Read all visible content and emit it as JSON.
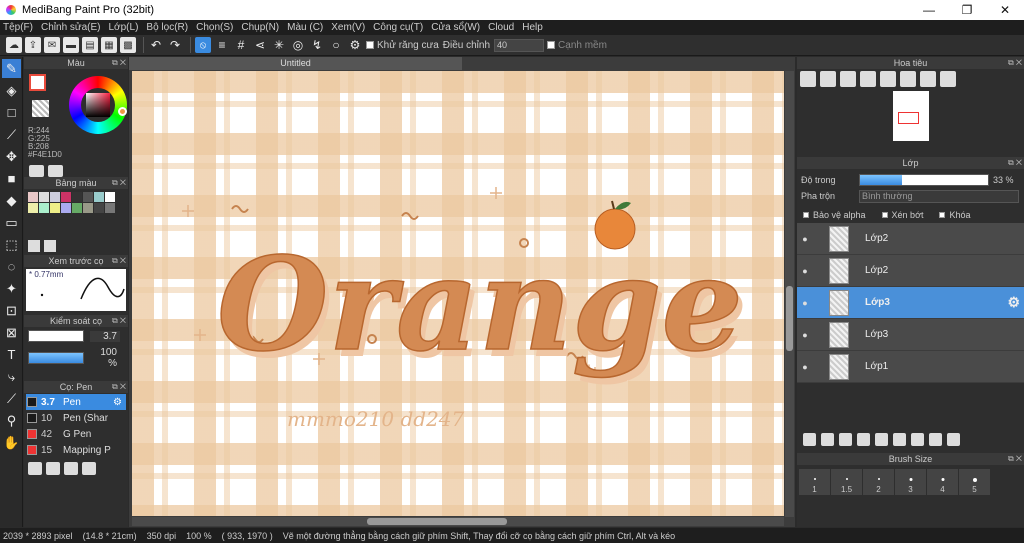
{
  "window": {
    "title": "MediBang Paint Pro (32bit)",
    "minimize": "—",
    "restore": "❐",
    "close": "✕"
  },
  "menu": [
    "Tệp(F)",
    "Chỉnh sửa(E)",
    "Lớp(L)",
    "Bộ lọc(R)",
    "Chọn(S)",
    "Chụp(N)",
    "Màu (C)",
    "Xem(V)",
    "Công cụ(T)",
    "Cửa sổ(W)",
    "Cloud",
    "Help"
  ],
  "toolbar": {
    "antialias_label": "Khử răng cưa",
    "correction_label": "Điều chỉnh",
    "correction_value": "40",
    "sharp_edge_label": "Cạnh mềm"
  },
  "panels": {
    "color_title": "Màu",
    "color_values": {
      "r": "R:244",
      "g": "G:225",
      "b": "B:208",
      "hex": "#F4E1D0"
    },
    "palette_title": "Bảng màu",
    "palette_colors": [
      "#e8c7c7",
      "#ddd",
      "#ccd",
      "#c36",
      "#333",
      "#555",
      "#9cc",
      "#fff",
      "#eea",
      "#aec",
      "#ee8",
      "#aae",
      "#6a6",
      "#998",
      "#444",
      "#777"
    ],
    "brush_preview_title": "Xem trước cọ",
    "brush_preview_size": "* 0.77mm",
    "brush_control_title": "Kiểm soát cọ",
    "brush_size_value": "3.7",
    "brush_opacity_value": "100 %",
    "brush_list_title": "Cọ: Pen",
    "brushes": [
      {
        "size": "3.7",
        "name": "Pen",
        "color": "#1a1a1a",
        "active": true
      },
      {
        "size": "10",
        "name": "Pen (Shar",
        "color": "#1a1a1a",
        "active": false
      },
      {
        "size": "42",
        "name": "G Pen",
        "color": "#e33",
        "active": false
      },
      {
        "size": "15",
        "name": "Mapping P",
        "color": "#e33",
        "active": false
      }
    ],
    "navigator_title": "Hoa tiêu",
    "layer_title": "Lớp",
    "opacity_label": "Độ trong",
    "opacity_value": "33 %",
    "opacity_fraction": 0.33,
    "blend_label": "Pha trộn",
    "blend_value": "Bình thường",
    "protect_alpha": "Bảo vệ alpha",
    "clipping": "Xén bớt",
    "lock": "Khóa",
    "layers": [
      {
        "name": "Lớp2",
        "active": false
      },
      {
        "name": "Lớp2",
        "active": false
      },
      {
        "name": "Lớp3",
        "active": true
      },
      {
        "name": "Lớp3",
        "active": false
      },
      {
        "name": "Lớp1",
        "active": false
      }
    ],
    "brush_size_title": "Brush Size",
    "brush_size_labels": [
      "1",
      "1.5",
      "2",
      "3",
      "4",
      "5"
    ]
  },
  "canvas": {
    "tab_title": "Untitled",
    "artwork_text": "Orange",
    "signature": "mmmo210 dd247"
  },
  "status": {
    "dimensions": "2039 * 2893 pixel",
    "physical": "(14.8 * 21cm)",
    "dpi": "350 dpi",
    "zoom": "100 %",
    "coords": "( 933, 1970 )",
    "hint": "Vẽ một đường thẳng bằng cách giữ phím Shift, Thay đổi cỡ cọ bằng cách giữ phím Ctrl, Alt và kéo"
  }
}
